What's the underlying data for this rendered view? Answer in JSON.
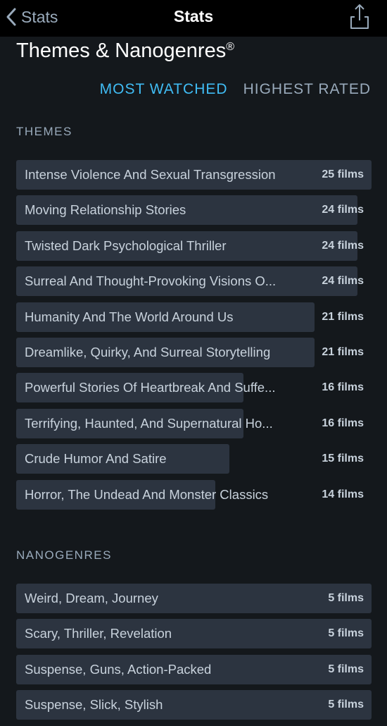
{
  "nav": {
    "back_label": "Stats",
    "title": "Stats",
    "share_icon": "share-icon"
  },
  "section": {
    "title": "Themes & Nanogenres",
    "title_mark": "®"
  },
  "tabs": [
    {
      "label": "MOST WATCHED",
      "active": true
    },
    {
      "label": "HIGHEST RATED",
      "active": false
    }
  ],
  "themes": {
    "label": "THEMES",
    "max_count": 25,
    "items": [
      {
        "label": "Intense Violence And Sexual Transgression",
        "count": 25,
        "count_label": "25 films"
      },
      {
        "label": "Moving Relationship Stories",
        "count": 24,
        "count_label": "24 films"
      },
      {
        "label": "Twisted Dark Psychological Thriller",
        "count": 24,
        "count_label": "24 films"
      },
      {
        "label": "Surreal And Thought-Provoking Visions O...",
        "count": 24,
        "count_label": "24 films"
      },
      {
        "label": "Humanity And The World Around Us",
        "count": 21,
        "count_label": "21 films"
      },
      {
        "label": "Dreamlike, Quirky, And Surreal Storytelling",
        "count": 21,
        "count_label": "21 films"
      },
      {
        "label": "Powerful Stories Of Heartbreak And Suffe...",
        "count": 16,
        "count_label": "16 films"
      },
      {
        "label": "Terrifying, Haunted, And Supernatural Ho...",
        "count": 16,
        "count_label": "16 films"
      },
      {
        "label": "Crude Humor And Satire",
        "count": 15,
        "count_label": "15 films"
      },
      {
        "label": "Horror, The Undead And Monster Classics",
        "count": 14,
        "count_label": "14 films"
      }
    ]
  },
  "nanogenres": {
    "label": "NANOGENRES",
    "max_count": 5,
    "items": [
      {
        "label": "Weird, Dream, Journey",
        "count": 5,
        "count_label": "5 films"
      },
      {
        "label": "Scary, Thriller, Revelation",
        "count": 5,
        "count_label": "5 films"
      },
      {
        "label": "Suspense, Guns, Action-Packed",
        "count": 5,
        "count_label": "5 films"
      },
      {
        "label": "Suspense, Slick, Stylish",
        "count": 5,
        "count_label": "5 films"
      }
    ]
  },
  "colors": {
    "accent": "#40bcf4",
    "background": "#14181c",
    "bar": "#2c3440"
  }
}
